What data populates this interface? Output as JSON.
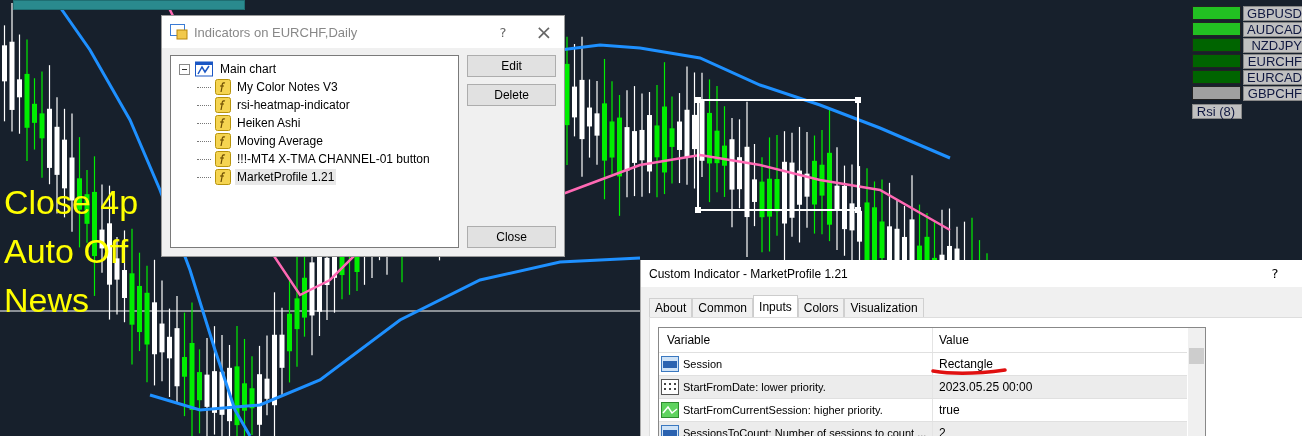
{
  "chart": {
    "overlay_text": [
      "Close 4p",
      "Auto Off",
      "News"
    ]
  },
  "heatmap": {
    "items": [
      {
        "label": "GBPUSD",
        "color": "#22c022"
      },
      {
        "label": "AUDCAD",
        "color": "#22c022"
      },
      {
        "label": "NZDJPY",
        "color": "#006400"
      },
      {
        "label": "EURCHF",
        "color": "#006400"
      },
      {
        "label": "EURCAD",
        "color": "#006400"
      },
      {
        "label": "GBPCHF",
        "color": "#a0a0a0"
      }
    ],
    "footer": "Rsi (8)"
  },
  "indicators_dialog": {
    "title": "Indicators on EURCHF,Daily",
    "help": "?",
    "close": "×",
    "tree": {
      "label": "Main chart",
      "expanded": true,
      "children": [
        {
          "label": "My Color Notes V3",
          "selected": false
        },
        {
          "label": "rsi-heatmap-indicator",
          "selected": false
        },
        {
          "label": "Heiken Ashi",
          "selected": false
        },
        {
          "label": "Moving Average",
          "selected": false
        },
        {
          "label": "!!!-MT4 X-TMA CHANNEL-01 button",
          "selected": false
        },
        {
          "label": "MarketProfile 1.21",
          "selected": true
        }
      ]
    },
    "buttons": [
      "Edit",
      "Delete"
    ],
    "close_button": "Close"
  },
  "custom_indicator_dialog": {
    "title": "Custom Indicator - MarketProfile 1.21",
    "help": "?",
    "tabs": [
      {
        "label": "About",
        "selected": false
      },
      {
        "label": "Common",
        "selected": false
      },
      {
        "label": "Inputs",
        "selected": true
      },
      {
        "label": "Colors",
        "selected": false
      },
      {
        "label": "Visualization",
        "selected": false
      }
    ],
    "columns": [
      "Variable",
      "Value"
    ],
    "rows": [
      {
        "kind": "number",
        "variable": "Session",
        "value": "Rectangle",
        "marked": true
      },
      {
        "kind": "date",
        "variable": "StartFromDate: lower priority.",
        "value": "2023.05.25 00:00",
        "marked": false
      },
      {
        "kind": "bool",
        "variable": "StartFromCurrentSession: higher priority.",
        "value": "true",
        "marked": false
      },
      {
        "kind": "number",
        "variable": "SessionsToCount: Number of sessions to count ...",
        "value": "2",
        "marked": false
      }
    ]
  }
}
